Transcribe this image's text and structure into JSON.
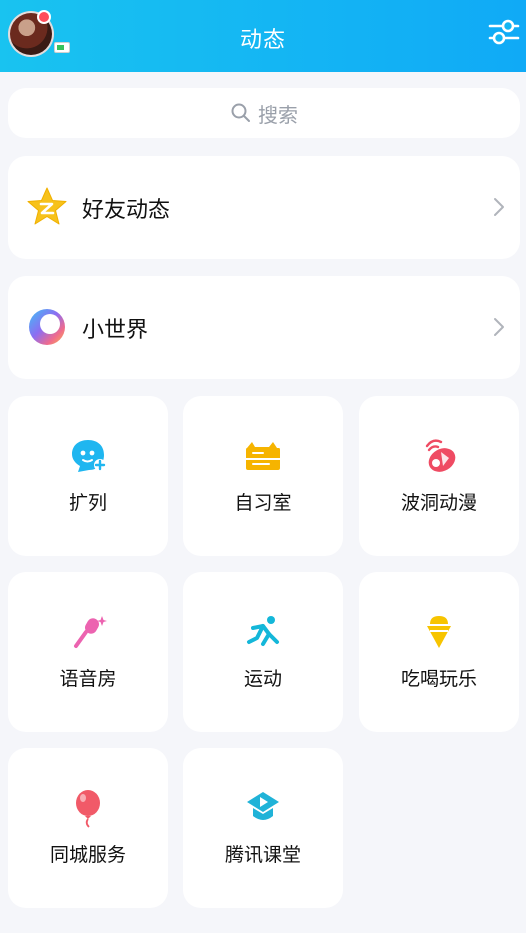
{
  "header": {
    "title": "动态",
    "avatar_icon": "user-avatar",
    "filter_icon": "sliders-icon",
    "accent": "#15b6f3"
  },
  "search": {
    "placeholder": "搜索",
    "icon": "search-icon"
  },
  "cards": [
    {
      "label": "好友动态",
      "icon": "qzone-star-icon"
    },
    {
      "label": "小世界",
      "icon": "small-world-icon"
    }
  ],
  "tiles": [
    {
      "label": "扩列",
      "icon": "kuolie-icon",
      "color": "#1fb6f0"
    },
    {
      "label": "自习室",
      "icon": "study-room-icon",
      "color": "#f6b400"
    },
    {
      "label": "波洞动漫",
      "icon": "anime-icon",
      "color": "#ef4b63"
    },
    {
      "label": "语音房",
      "icon": "microphone-icon",
      "color": "#ec63b0"
    },
    {
      "label": "运动",
      "icon": "running-icon",
      "color": "#14b7d9"
    },
    {
      "label": "吃喝玩乐",
      "icon": "food-icon",
      "color": "#f7c400"
    },
    {
      "label": "同城服务",
      "icon": "balloon-icon",
      "color": "#f15a68"
    },
    {
      "label": "腾讯课堂",
      "icon": "classroom-icon",
      "color": "#20b3d8"
    }
  ]
}
